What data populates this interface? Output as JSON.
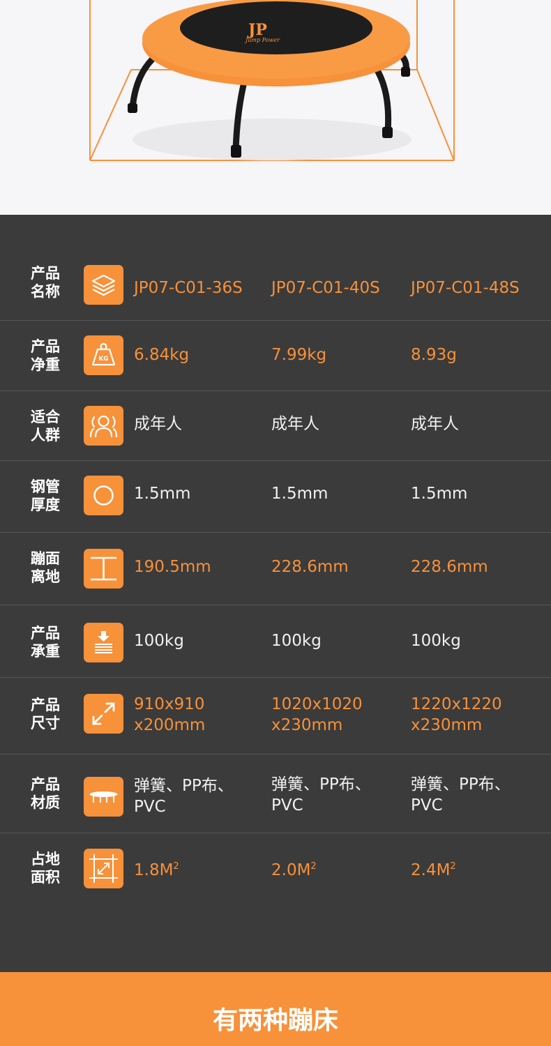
{
  "hero": {
    "brand_logo": "JP",
    "brand_tagline": "Jump Power",
    "colors": {
      "frame": "#f7913a",
      "pad": "#f7913a",
      "mat": "#1e1e1e",
      "legs": "#1a1a1a"
    }
  },
  "specs": {
    "colors": {
      "background": "#3b3b3b",
      "accent": "#f7913a",
      "text": "#f1f1f1",
      "divider": "#555555"
    },
    "rows": [
      {
        "label": [
          "产品",
          "名称"
        ],
        "icon": "layers-icon",
        "style": "orange",
        "values": [
          "JP07-C01-36S",
          "JP07-C01-40S",
          "JP07-C01-48S"
        ]
      },
      {
        "label": [
          "产品",
          "净重"
        ],
        "icon": "kg-weight-icon",
        "style": "orange",
        "values": [
          "6.84kg",
          "7.99kg",
          "8.93g"
        ]
      },
      {
        "label": [
          "适合",
          "人群"
        ],
        "icon": "people-icon",
        "style": "white",
        "values": [
          "成年人",
          "成年人",
          "成年人"
        ]
      },
      {
        "label": [
          "钢管",
          "厚度"
        ],
        "icon": "circle-icon",
        "style": "white",
        "values": [
          "1.5mm",
          "1.5mm",
          "1.5mm"
        ]
      },
      {
        "label": [
          "蹦面",
          "离地"
        ],
        "icon": "height-icon",
        "style": "orange",
        "values": [
          "190.5mm",
          "228.6mm",
          "228.6mm"
        ]
      },
      {
        "label": [
          "产品",
          "承重"
        ],
        "icon": "load-bearing-icon",
        "style": "white",
        "values": [
          "100kg",
          "100kg",
          "100kg"
        ]
      },
      {
        "label": [
          "产品",
          "尺寸"
        ],
        "icon": "expand-arrows-icon",
        "style": "orange",
        "values": [
          [
            "910x910",
            "x200mm"
          ],
          [
            "1020x1020",
            "x230mm"
          ],
          [
            "1220x1220",
            "x230mm"
          ]
        ]
      },
      {
        "label": [
          "产品",
          "材质"
        ],
        "icon": "trampoline-icon",
        "style": "white",
        "values": [
          [
            "弹簧、PP布、",
            "PVC"
          ],
          [
            "弹簧、PP布、",
            "PVC"
          ],
          [
            "弹簧、PP布、",
            "PVC"
          ]
        ]
      },
      {
        "label": [
          "占地",
          "面积"
        ],
        "icon": "area-frame-icon",
        "style": "orange",
        "values": [
          {
            "num": "1.8M",
            "sup": "2"
          },
          {
            "num": "2.0M",
            "sup": "2"
          },
          {
            "num": "2.4M",
            "sup": "2"
          }
        ]
      }
    ]
  },
  "banner": {
    "title": "有两种蹦床"
  }
}
